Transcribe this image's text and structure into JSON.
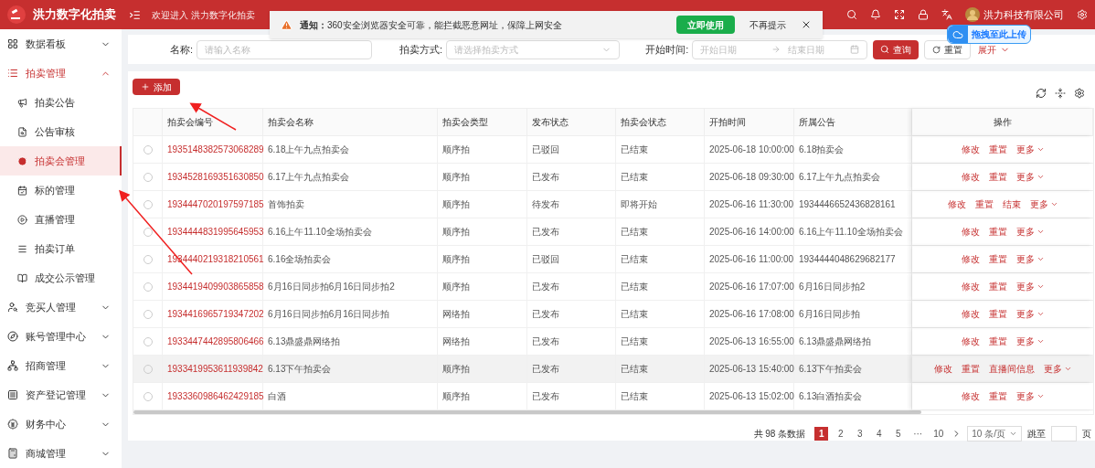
{
  "header": {
    "app_title": "洪力数字化拍卖",
    "welcome": "欢迎进入 洪力数字化拍卖",
    "user_name": "洪力科技有限公司"
  },
  "notification": {
    "message": "**通知：**360安全浏览器安全可靠，能拦截恶意网址，保障上网安全",
    "use_button": "立即使用",
    "dismiss_link": "不再提示"
  },
  "upload_tag": {
    "label": "拖拽至此上传"
  },
  "sidebar": {
    "items": [
      {
        "label": "数据看板",
        "expanded": false,
        "selected": false
      },
      {
        "label": "拍卖管理",
        "expanded": true,
        "selected": false,
        "children": [
          {
            "label": "拍卖公告",
            "selected": false
          },
          {
            "label": "公告审核",
            "selected": false
          },
          {
            "label": "拍卖会管理",
            "selected": true
          },
          {
            "label": "标的管理",
            "selected": false
          },
          {
            "label": "直播管理",
            "selected": false
          },
          {
            "label": "拍卖订单",
            "selected": false
          },
          {
            "label": "成交公示管理",
            "selected": false
          }
        ]
      },
      {
        "label": "竞买人管理",
        "expanded": false,
        "selected": false
      },
      {
        "label": "账号管理中心",
        "expanded": false,
        "selected": false
      },
      {
        "label": "招商管理",
        "expanded": false,
        "selected": false
      },
      {
        "label": "资产登记管理",
        "expanded": false,
        "selected": false
      },
      {
        "label": "财务中心",
        "expanded": false,
        "selected": false
      },
      {
        "label": "商城管理",
        "expanded": false,
        "selected": false
      }
    ]
  },
  "filters": {
    "name_label": "名称:",
    "name_placeholder": "请输入名称",
    "method_label": "拍卖方式:",
    "method_placeholder": "请选择拍卖方式",
    "time_label": "开始时间:",
    "start_placeholder": "开始日期",
    "end_placeholder": "结束日期",
    "search_button": "查询",
    "reset_button": "重置",
    "expand_link": "展开"
  },
  "add_button": "添加",
  "table": {
    "columns": [
      "拍卖会编号",
      "拍卖会名称",
      "拍卖会类型",
      "发布状态",
      "拍卖会状态",
      "开拍时间",
      "所属公告",
      "操作"
    ],
    "rows": [
      {
        "selected": false,
        "highlighted": false,
        "cells": [
          "1935148382573068289",
          "6.18上午九点拍卖会",
          "顺序拍",
          "已驳回",
          "已结束",
          "2025-06-18 10:00:00",
          "6.18拍卖会"
        ],
        "actions": [
          "修改",
          "重置",
          "更多"
        ]
      },
      {
        "selected": false,
        "highlighted": false,
        "cells": [
          "1934528169351630850",
          "6.17上午九点拍卖会",
          "顺序拍",
          "已发布",
          "已结束",
          "2025-06-18 09:30:00",
          "6.17上午九点拍卖会"
        ],
        "actions": [
          "修改",
          "重置",
          "更多"
        ]
      },
      {
        "selected": false,
        "highlighted": false,
        "cells": [
          "1934447020197597185",
          "首饰拍卖",
          "顺序拍",
          "待发布",
          "即将开始",
          "2025-06-16 11:30:00",
          "1934446652436828161"
        ],
        "actions": [
          "修改",
          "重置",
          "结束",
          "更多"
        ]
      },
      {
        "selected": false,
        "highlighted": false,
        "cells": [
          "1934444831995645953",
          "6.16上午11.10全场拍卖会",
          "顺序拍",
          "已发布",
          "已结束",
          "2025-06-16 14:00:00",
          "6.16上午11.10全场拍卖会"
        ],
        "actions": [
          "修改",
          "重置",
          "更多"
        ]
      },
      {
        "selected": false,
        "highlighted": false,
        "cells": [
          "1934440219318210561",
          "6.16全场拍卖会",
          "顺序拍",
          "已驳回",
          "已结束",
          "2025-06-16 11:00:00",
          "1934444048629682177"
        ],
        "actions": [
          "修改",
          "重置",
          "更多"
        ]
      },
      {
        "selected": false,
        "highlighted": false,
        "cells": [
          "1934419409903865858",
          "6月16日同步拍6月16日同步拍2",
          "顺序拍",
          "已发布",
          "已结束",
          "2025-06-16 17:07:00",
          "6月16日同步拍2"
        ],
        "actions": [
          "修改",
          "重置",
          "更多"
        ]
      },
      {
        "selected": false,
        "highlighted": false,
        "cells": [
          "1934416965719347202",
          "6月16日同步拍6月16日同步拍",
          "网络拍",
          "已发布",
          "已结束",
          "2025-06-16 17:08:00",
          "6月16日同步拍"
        ],
        "actions": [
          "修改",
          "重置",
          "更多"
        ]
      },
      {
        "selected": false,
        "highlighted": false,
        "cells": [
          "1933447442895806466",
          "6.13鼎盛鼎网络拍",
          "网络拍",
          "已发布",
          "已结束",
          "2025-06-13 16:55:00",
          "6.13鼎盛鼎网络拍"
        ],
        "actions": [
          "修改",
          "重置",
          "更多"
        ]
      },
      {
        "selected": false,
        "highlighted": true,
        "cells": [
          "1933419953611939842",
          "6.13下午拍卖会",
          "顺序拍",
          "已发布",
          "已结束",
          "2025-06-13 15:40:00",
          "6.13下午拍卖会"
        ],
        "actions": [
          "修改",
          "重置",
          "直播间信息",
          "更多"
        ]
      },
      {
        "selected": false,
        "highlighted": false,
        "cells": [
          "1933360986462429185",
          "白酒",
          "顺序拍",
          "已发布",
          "已结束",
          "2025-06-13 15:02:00",
          "6.13白酒拍卖会"
        ],
        "actions": [
          "修改",
          "重置",
          "更多"
        ]
      }
    ]
  },
  "pagination": {
    "total": "共 98 条数据",
    "pages": [
      {
        "label": "1",
        "selected": true
      },
      {
        "label": "2",
        "selected": false
      },
      {
        "label": "3",
        "selected": false
      },
      {
        "label": "4",
        "selected": false
      },
      {
        "label": "5",
        "selected": false
      },
      {
        "label": "···",
        "selected": false
      },
      {
        "label": "10",
        "selected": false
      }
    ],
    "page_size": "10 条/页",
    "jump_label": "跳至",
    "page_unit": "页"
  }
}
